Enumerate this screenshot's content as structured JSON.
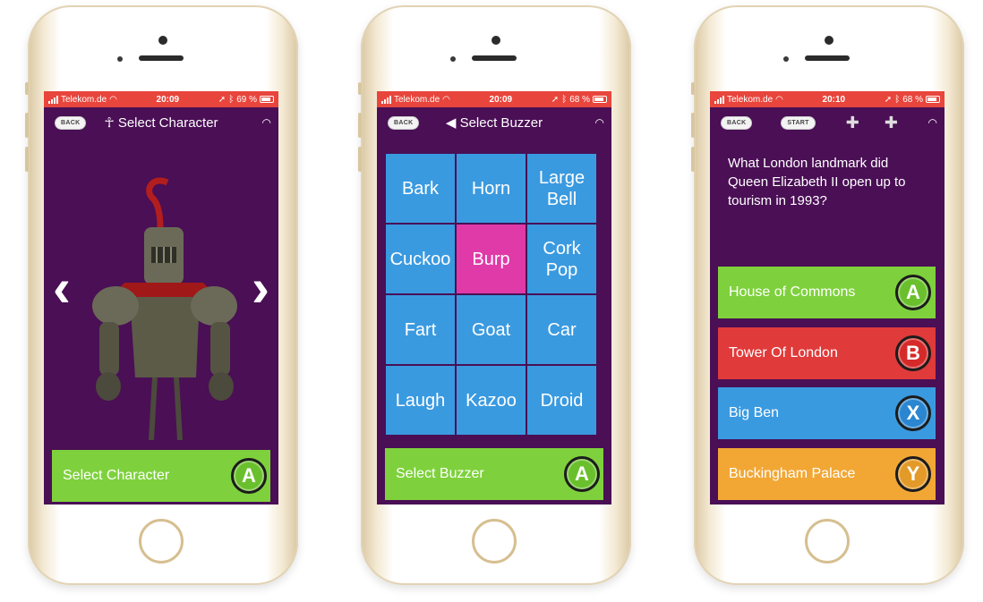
{
  "status_bars": [
    {
      "carrier": "Telekom.de",
      "time": "20:09",
      "battery": "69 %"
    },
    {
      "carrier": "Telekom.de",
      "time": "20:09",
      "battery": "68 %"
    },
    {
      "carrier": "Telekom.de",
      "time": "20:10",
      "battery": "68 %"
    }
  ],
  "screen1": {
    "back_label": "BACK",
    "title": "Select Character",
    "select_button": "Select Character",
    "select_button_badge": "A"
  },
  "screen2": {
    "back_label": "BACK",
    "title": "Select Buzzer",
    "buzzers": [
      "Bark",
      "Horn",
      "Large\nBell",
      "Cuckoo",
      "Burp",
      "Cork\nPop",
      "Fart",
      "Goat",
      "Car",
      "Laugh",
      "Kazoo",
      "Droid"
    ],
    "selected_buzzer": "Burp",
    "select_button": "Select Buzzer",
    "select_button_badge": "A"
  },
  "screen3": {
    "back_label": "BACK",
    "start_label": "START",
    "question": "What London landmark did Queen Elizabeth II open up to tourism in 1993?",
    "answers": [
      {
        "text": "House of Commons",
        "badge": "A",
        "color": "#7ed13c"
      },
      {
        "text": "Tower Of London",
        "badge": "B",
        "color": "#e03a3a"
      },
      {
        "text": "Big Ben",
        "badge": "X",
        "color": "#3a9ae0"
      },
      {
        "text": "Buckingham Palace",
        "badge": "Y",
        "color": "#f2a735"
      }
    ]
  },
  "colors": {
    "screen_bg": "#4a0f55",
    "status_bar": "#e8453c",
    "accent_green": "#7ed13c",
    "tile_blue": "#3a9ae0",
    "tile_selected": "#e03aa8"
  },
  "icons": [
    "signal-bars-icon",
    "wifi-icon",
    "location-arrow-icon",
    "bluetooth-icon",
    "battery-icon",
    "person-icon",
    "speaker-icon",
    "dpad-icon",
    "chevron-left-icon",
    "chevron-right-icon",
    "knight-character-image",
    "home-button"
  ]
}
